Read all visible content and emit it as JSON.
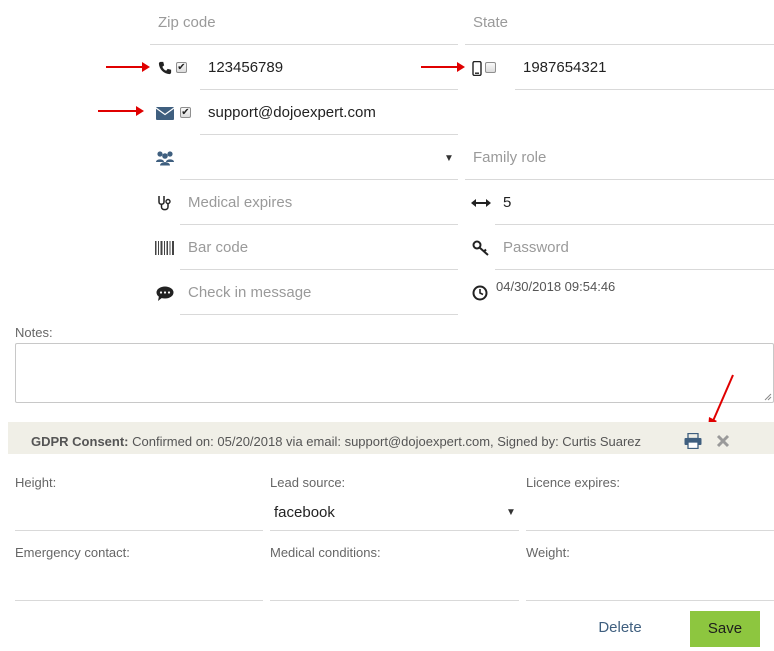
{
  "fields": {
    "zip_code": {
      "placeholder": "Zip code"
    },
    "state": {
      "placeholder": "State"
    },
    "phone": {
      "value": "123456789",
      "checked": true
    },
    "mobile": {
      "value": "1987654321",
      "checked": false
    },
    "email": {
      "value": "support@dojoexpert.com",
      "checked": true
    },
    "family": {
      "value": ""
    },
    "family_role": {
      "placeholder": "Family role"
    },
    "medical_expires": {
      "placeholder": "Medical expires"
    },
    "height_rank": {
      "value": "5"
    },
    "bar_code": {
      "placeholder": "Bar code"
    },
    "password": {
      "placeholder": "Password"
    },
    "check_in_message": {
      "placeholder": "Check in message"
    },
    "timestamp": {
      "value": "04/30/2018 09:54:46"
    }
  },
  "notes": {
    "label": "Notes:"
  },
  "gdpr": {
    "label": "GDPR Consent:",
    "text": "Confirmed on: 05/20/2018 via email: support@dojoexpert.com, Signed by: Curtis Suarez"
  },
  "extra": {
    "height_label": "Height:",
    "lead_source_label": "Lead source:",
    "lead_source_value": "facebook",
    "licence_label": "Licence expires:",
    "emergency_label": "Emergency contact:",
    "medical_conditions_label": "Medical conditions:",
    "weight_label": "Weight:"
  },
  "actions": {
    "delete": "Delete",
    "save": "Save"
  },
  "colors": {
    "accent_save": "#8dc63f",
    "icon_blue": "#3f5f7f",
    "arrow_red": "#e00000"
  }
}
